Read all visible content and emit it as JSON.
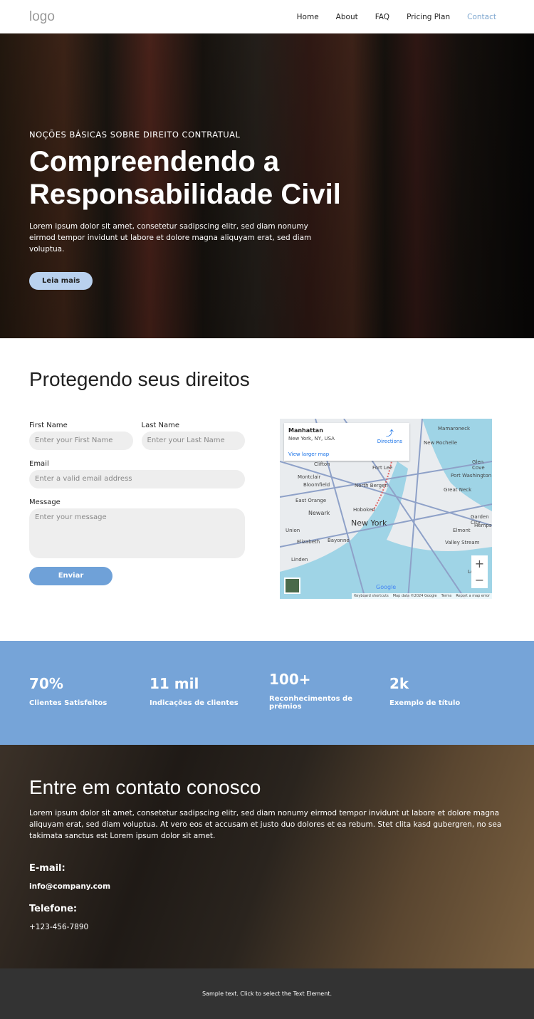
{
  "header": {
    "logo": "logo",
    "nav": [
      "Home",
      "About",
      "FAQ",
      "Pricing Plan",
      "Contact"
    ]
  },
  "hero": {
    "kicker": "NOÇÕES BÁSICAS SOBRE DIREITO CONTRATUAL",
    "title_line1": "Compreendendo a",
    "title_line2": "Responsabilidade Civil",
    "text": "Lorem ipsum dolor sit amet, consetetur sadipscing elitr, sed diam nonumy eirmod tempor invidunt ut labore et dolore magna aliquyam erat, sed diam voluptua.",
    "button": "Leia mais"
  },
  "form_section": {
    "title": "Protegendo seus direitos",
    "first_name_label": "First Name",
    "first_name_placeholder": "Enter your First Name",
    "last_name_label": "Last Name",
    "last_name_placeholder": "Enter your Last Name",
    "email_label": "Email",
    "email_placeholder": "Enter a valid email address",
    "message_label": "Message",
    "message_placeholder": "Enter your message",
    "submit": "Enviar"
  },
  "map": {
    "place": "Manhattan",
    "address": "New York, NY, USA",
    "directions": "Directions",
    "larger": "View larger map",
    "city": "New York",
    "labels": [
      "Mamaroneck",
      "New Rochelle",
      "Clifton",
      "Fort Lee",
      "Glen Cove",
      "Montclair",
      "Port Washington",
      "Bloomfield",
      "North Bergen",
      "Great Neck",
      "East Orange",
      "Newark",
      "Hoboken",
      "Garden City",
      "Union",
      "Elmont",
      "Hempstead",
      "Elizabeth",
      "Bayonne",
      "Valley Stream",
      "Linden",
      "Long"
    ],
    "footer": [
      "Keyboard shortcuts",
      "Map data ©2024 Google",
      "Terms",
      "Report a map error"
    ],
    "brand": "Google",
    "colors": {
      "water": "#9fd4e6",
      "land": "#e9ecef",
      "road": "#8ea1c8"
    }
  },
  "stats": [
    {
      "value": "70%",
      "label": "Clientes Satisfeitos"
    },
    {
      "value": "11 mil",
      "label": "Indicações de clientes"
    },
    {
      "value": "100+",
      "label": "Reconhecimentos de prêmios"
    },
    {
      "value": "2k",
      "label": "Exemplo de título"
    }
  ],
  "contact": {
    "title": "Entre em contato conosco",
    "text": "Lorem ipsum dolor sit amet, consetetur sadipscing elitr, sed diam nonumy eirmod tempor invidunt ut labore et dolore magna aliquyam erat, sed diam voluptua. At vero eos et accusam et justo duo dolores et ea rebum. Stet clita kasd gubergren, no sea takimata sanctus est Lorem ipsum dolor sit amet.",
    "email_label": "E-mail:",
    "email": "info@company.com",
    "phone_label": "Telefone:",
    "phone": "+123-456-7890"
  },
  "footer": {
    "text": "Sample text. Click to select the Text Element."
  }
}
